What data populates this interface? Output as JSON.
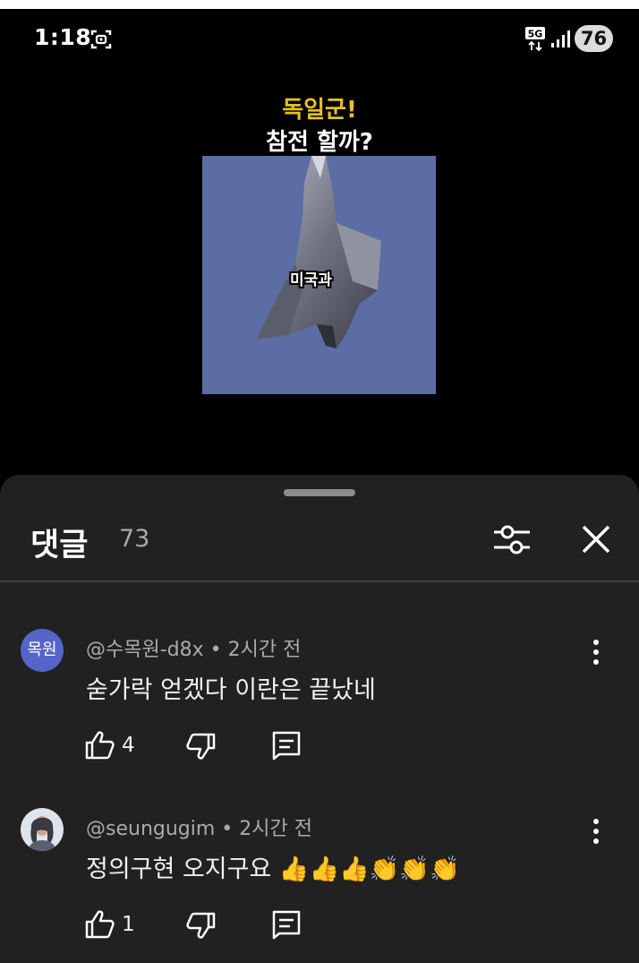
{
  "status_bar": {
    "time": "1:18",
    "network": "5G",
    "battery": "76"
  },
  "video": {
    "title_line1": "독일군!",
    "title_line2": "참전 할까?",
    "caption": "미국과"
  },
  "comments_panel": {
    "title": "댓글",
    "count": "73",
    "comments": [
      {
        "avatar_text": "목원",
        "author": "@수목원-d8x",
        "separator": " • ",
        "time": "2시간 전",
        "text": "숟가락 얻겠다 이란은  끝났네",
        "likes": "4"
      },
      {
        "author": "@seungugim",
        "separator": " • ",
        "time": "2시간 전",
        "text": "정의구현 오지구요 👍👍👍👏👏👏",
        "likes": "1"
      }
    ]
  },
  "colors": {
    "panel_bg": "#212121",
    "title_yellow": "#e6c027",
    "avatar_blue": "#5564c9",
    "sky_blue": "#5c6da6"
  }
}
